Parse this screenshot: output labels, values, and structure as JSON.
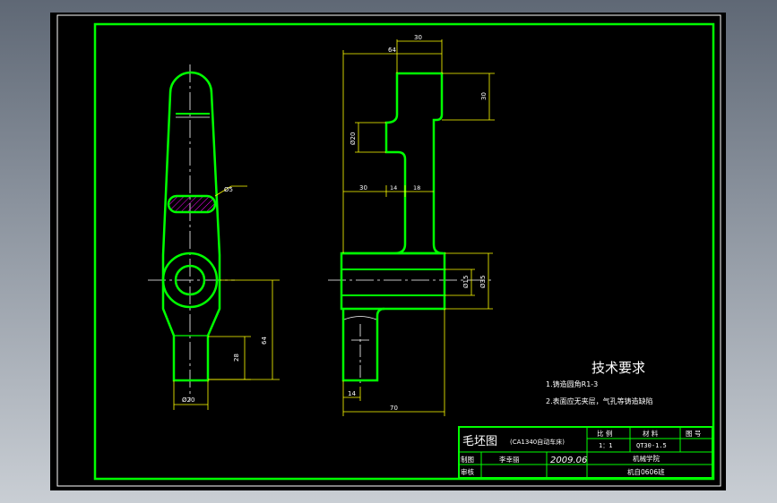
{
  "colors": {
    "background": "#000000",
    "frame": "#00ff00",
    "centerline": "#ffffff",
    "dimension": "#ffff00",
    "text": "#ffffff",
    "hatch": "#ff00ff",
    "outer_bg": "#8a929d"
  },
  "dimensions": {
    "top_30": "30",
    "top_64": "64",
    "right_30": "30",
    "dia_20_upper": "Ø20",
    "mid_30": "30",
    "mid_14": "14",
    "mid_18": "18",
    "dia_15": "Ø15",
    "dia_35": "Ø35",
    "bottom_14": "14",
    "bottom_70": "70",
    "left_dia_5": "Ø5",
    "left_28": "28",
    "left_64": "64",
    "left_dia_20": "Ø20"
  },
  "tech": {
    "title": "技术要求",
    "line1": "1.铸造圆角R1-3",
    "line2": "2.表面应无夹层，气孔等铸造缺陷"
  },
  "title_block": {
    "drawing_name": "毛坯图",
    "part_desc": "(CA1340自动车床)",
    "ratio_label": "比 例",
    "material_label": "材 料",
    "drawing_no_label": "图 号",
    "ratio_value": "1：1",
    "material_value": "QT30-1.5",
    "drawing_label": "制图",
    "review_label": "审核",
    "author": "李幸丽",
    "date": "2009.06",
    "school": "机械学院",
    "class_name": "机自0606班"
  }
}
